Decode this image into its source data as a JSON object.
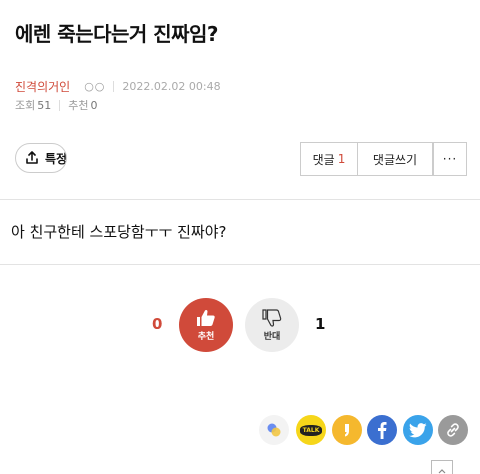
{
  "post": {
    "title": "에렌 죽는다는거 진짜임?",
    "author": "진격의거인",
    "author_dots": "○○",
    "date": "2022.02.02 00:48",
    "views_label": "조회",
    "views": "51",
    "recommend_label": "추천",
    "recommend": "0",
    "content": "아 친구한테 스포당함ㅜㅜ 진짜야?"
  },
  "toolbar": {
    "share_label": "특정",
    "comment_label": "댓글",
    "comment_count": "1",
    "write_comment_label": "댓글쓰기",
    "more_label": "···"
  },
  "vote": {
    "up_label": "추천",
    "up_count": "0",
    "down_label": "반대",
    "down_count": "1"
  },
  "sns": {
    "talk_text": "TALK",
    "icons": [
      "blog-icon",
      "kakaotalk-icon",
      "kakaostory-icon",
      "facebook-icon",
      "twitter-icon",
      "link-icon"
    ]
  },
  "colors": {
    "accent": "#d04a3a",
    "facebook": "#3b6fd0",
    "twitter": "#3aa3ea",
    "kakao": "#f6d61a"
  }
}
